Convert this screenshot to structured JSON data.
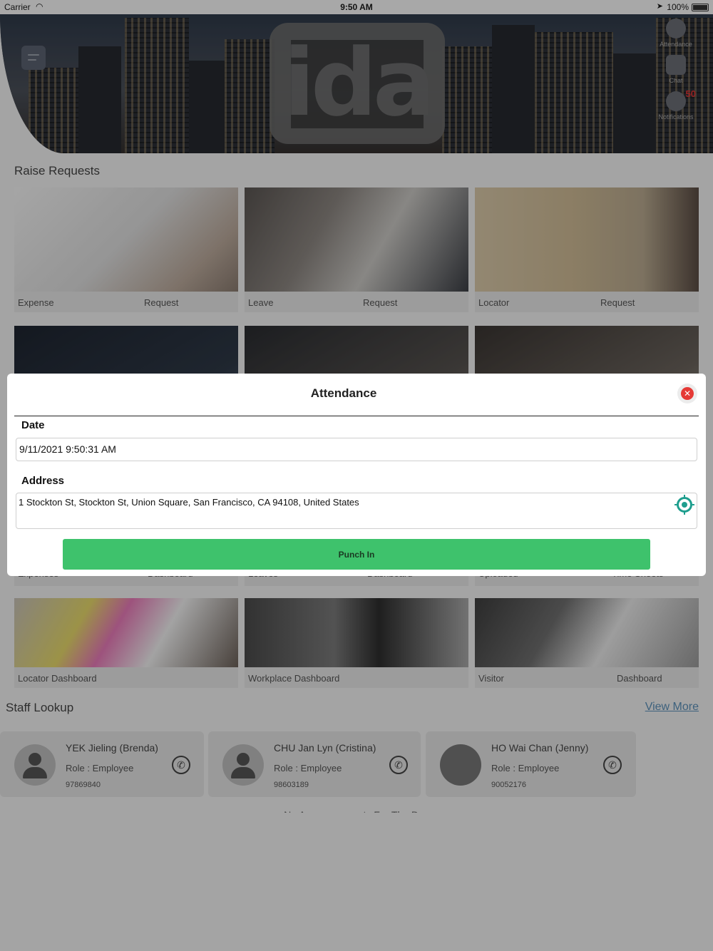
{
  "status_bar": {
    "carrier": "Carrier",
    "time": "9:50 AM",
    "battery": "100%"
  },
  "header": {
    "logo_text": "ida",
    "side_items": [
      {
        "label": "Attendance",
        "icon": "user-avatar-icon"
      },
      {
        "label": "Chat",
        "icon": "chat-icon"
      },
      {
        "label": "Notifications",
        "icon": "bell-icon",
        "badge": "50"
      }
    ]
  },
  "raise_requests": {
    "title": "Raise Requests",
    "cards": [
      {
        "left": "Expense",
        "right": "Request"
      },
      {
        "left": "Leave",
        "right": "Request"
      },
      {
        "left": "Locator",
        "right": "Request"
      }
    ],
    "partial_cards": [
      {
        "left": "Expenses",
        "right": "Dashboard"
      },
      {
        "left": "Leaves",
        "right": "Dashboard"
      },
      {
        "left": "Uploaded",
        "right": "Time Sheets"
      }
    ],
    "dashboard_cards": [
      {
        "left": "Locator Dashboard",
        "right": ""
      },
      {
        "left": "Workplace Dashboard",
        "right": ""
      },
      {
        "left": "Visitor",
        "right": "Dashboard"
      }
    ]
  },
  "staff_lookup": {
    "title": "Staff Lookup",
    "view_more": "View More",
    "staff": [
      {
        "name": "YEK Jieling (Brenda)",
        "role": "Role : Employee",
        "phone": "97869840"
      },
      {
        "name": "CHU Jan Lyn (Cristina)",
        "role": "Role : Employee",
        "phone": "98603189"
      },
      {
        "name": "HO Wai Chan (Jenny)",
        "role": "Role : Employee",
        "phone": "90052176"
      }
    ],
    "announcement": "No Announcements For The Day"
  },
  "modal": {
    "title": "Attendance",
    "date_label": "Date",
    "date_value": "9/11/2021 9:50:31 AM",
    "address_label": "Address",
    "address_value": "1 Stockton St, Stockton St, Union Square, San Francisco, CA 94108, United States",
    "punch_label": "Punch In"
  },
  "colors": {
    "accent_green": "#3ec26c",
    "close_red": "#e53935",
    "location_teal": "#1e9e8e",
    "link_blue": "#5a8fb8"
  }
}
